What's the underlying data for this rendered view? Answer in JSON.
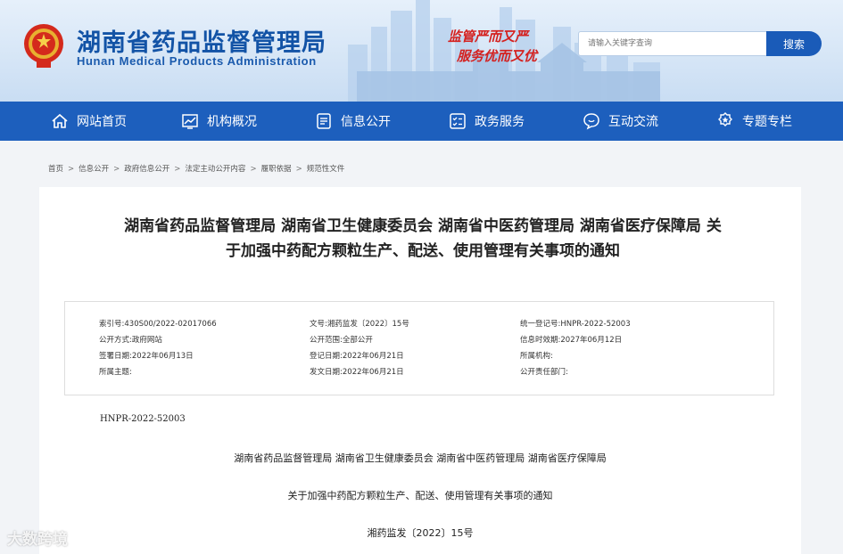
{
  "header": {
    "title_cn": "湖南省药品监督管理局",
    "title_en": "Hunan Medical Products Administration",
    "slogan_line1": "监管严而又严",
    "slogan_line2": "服务优而又优",
    "search_placeholder": "请输入关键字查询",
    "search_button": "搜索"
  },
  "nav": {
    "items": [
      {
        "label": "网站首页",
        "icon": "home-icon"
      },
      {
        "label": "机构概况",
        "icon": "chart-icon"
      },
      {
        "label": "信息公开",
        "icon": "document-icon"
      },
      {
        "label": "政务服务",
        "icon": "checklist-icon"
      },
      {
        "label": "互动交流",
        "icon": "chat-icon"
      },
      {
        "label": "专题专栏",
        "icon": "badge-icon"
      }
    ]
  },
  "breadcrumb": [
    "首页",
    "信息公开",
    "政府信息公开",
    "法定主动公开内容",
    "履职依据",
    "规范性文件"
  ],
  "document": {
    "title_line1": "湖南省药品监督管理局 湖南省卫生健康委员会 湖南省中医药管理局 湖南省医疗保障局 关",
    "title_line2": "于加强中药配方颗粒生产、配送、使用管理有关事项的通知",
    "meta": {
      "index_no_label": "索引号:",
      "index_no": "430S00/2022-02017066",
      "doc_no_label": "文号:",
      "doc_no": "湘药监发〔2022〕15号",
      "unified_no_label": "统一登记号:",
      "unified_no": "HNPR-2022-52003",
      "method_label": "公开方式:",
      "method": "政府网站",
      "scope_label": "公开范围:",
      "scope": "全部公开",
      "valid_label": "信息时效期:",
      "valid": "2027年06月12日",
      "signed_label": "签署日期:",
      "signed": "2022年06月13日",
      "registered_label": "登记日期:",
      "registered": "2022年06月21日",
      "agency_label": "所属机构:",
      "agency": "",
      "topic_label": "所属主题:",
      "topic": "",
      "issued_label": "发文日期:",
      "issued": "2022年06月21日",
      "responsible_label": "公开责任部门:",
      "responsible": ""
    },
    "code": "HNPR-2022-52003",
    "issuers": "湖南省药品监督管理局  湖南省卫生健康委员会  湖南省中医药管理局   湖南省医疗保障局",
    "subtitle": "关于加强中药配方颗粒生产、配送、使用管理有关事项的通知",
    "doc_number": "湘药监发〔2022〕15号"
  },
  "watermark": "大数跨境",
  "colors": {
    "primary": "#1d5fbd",
    "title_blue": "#1253a6",
    "slogan_red": "#d4211f"
  }
}
